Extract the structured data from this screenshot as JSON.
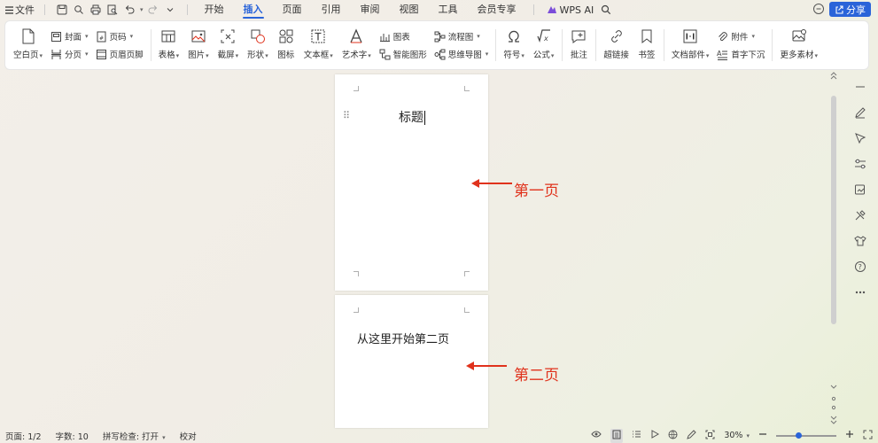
{
  "menubar": {
    "menu_icon": "hamburger-icon",
    "file_label": "文件",
    "tabs": [
      "开始",
      "插入",
      "页面",
      "引用",
      "审阅",
      "视图",
      "工具",
      "会员专享"
    ],
    "active_tab": "插入",
    "wps_ai_label": "WPS AI",
    "share_label": "分享"
  },
  "ribbon": {
    "blank_page": "空白页",
    "cover": "封面",
    "page_break": "分页",
    "page_number": "页码",
    "header_footer": "页眉页脚",
    "table": "表格",
    "picture": "图片",
    "screenshot": "截屏",
    "shape": "形状",
    "icons": "图标",
    "textbox": "文本框",
    "wordart": "艺术字",
    "chart": "图表",
    "smart_graphic": "智能图形",
    "flowchart": "流程图",
    "mindmap": "思维导图",
    "symbol": "符号",
    "formula": "公式",
    "comment": "批注",
    "hyperlink": "超链接",
    "bookmark": "书签",
    "doc_parts": "文档部件",
    "attachment": "附件",
    "drop_cap": "首字下沉",
    "more_materials": "更多素材"
  },
  "document": {
    "page1_text": "标题",
    "page2_text": "从这里开始第二页",
    "annotation_page1": "第一页",
    "annotation_page2": "第二页"
  },
  "status": {
    "page": "页面: 1/2",
    "word_count": "字数: 10",
    "spell_check": "拼写检查: 打开",
    "proofread": "校对",
    "zoom": "30%"
  },
  "colors": {
    "accent": "#2a64d9",
    "annotation": "#e0321c"
  }
}
